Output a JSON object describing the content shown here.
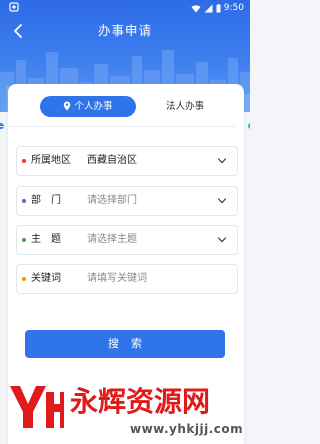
{
  "status_bar": {
    "time": "9:50"
  },
  "header": {
    "title": "办事申请",
    "back_icon": "arrow-left-icon"
  },
  "tabs": {
    "personal_label": "个人办事",
    "legal_label": "法人办事",
    "active": "personal"
  },
  "form": {
    "fields": [
      {
        "label": "所属地区",
        "value": "西藏自治区",
        "placeholder": "",
        "dot_color": "#e53935"
      },
      {
        "label": "部　门",
        "value": "",
        "placeholder": "请选择部门",
        "dot_color": "#7e57c2"
      },
      {
        "label": "主　题",
        "value": "",
        "placeholder": "请选择主题",
        "dot_color": "#43a047"
      },
      {
        "label": "关键词",
        "value": "",
        "placeholder": "请填写关键词",
        "dot_color": "#fb8c00"
      }
    ],
    "search_label": "搜索"
  },
  "watermark": {
    "brand": "永辉资源网",
    "url": "www.yhkjjj.com"
  },
  "colors": {
    "primary": "#2f74e8",
    "header_gradient_top": "#2e6be6",
    "background": "#f3f5f9"
  }
}
